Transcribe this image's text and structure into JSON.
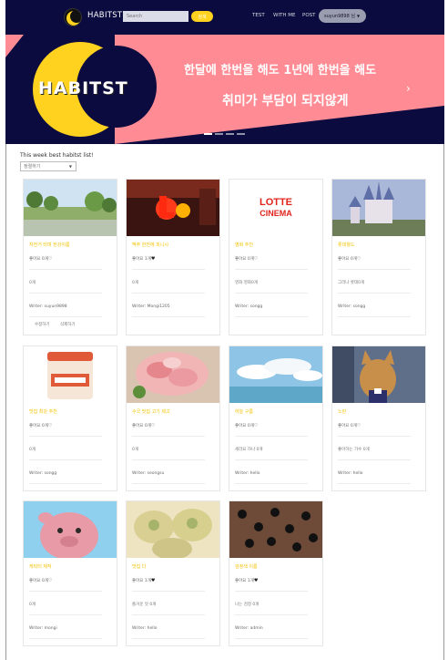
{
  "nav": {
    "brand": "HABITST",
    "search_placeholder": "Search",
    "search_button": "검색",
    "links": [
      "TEST",
      "WITH ME",
      "POST"
    ],
    "user": "suyun9898 님"
  },
  "banner": {
    "logo_text": "HABITST",
    "line1": "한달에 한번을 해도 1년에 한번을 해도",
    "line2": "취미가 부담이 되지않게",
    "next_arrow": "›"
  },
  "list": {
    "title": "This week best habitst list!",
    "sort_value": "정렬하기"
  },
  "cards": [
    {
      "title": "자전거 타며 한강이름",
      "likes": "좋아요 0개",
      "liked": false,
      "desc": "0개",
      "writer": "Writer: suyun9898",
      "actions": [
        "수정하기",
        "삭제하기"
      ],
      "thumb": "park"
    },
    {
      "title": "맥주 한잔에 피니시",
      "likes": "좋아요 1개",
      "liked": true,
      "desc": "0개",
      "writer": "Writer: Mongi1205",
      "thumb": "sign"
    },
    {
      "title": "영화 추천",
      "likes": "좋아요 0개",
      "liked": false,
      "desc": "영화 영화0개",
      "writer": "Writer: songg",
      "thumb": "cinema"
    },
    {
      "title": "롯데월드",
      "likes": "좋아요 0개",
      "liked": false,
      "desc": "그리나 롯데0개",
      "writer": "Writer: songg",
      "thumb": "castle"
    },
    {
      "title": "맛집 최강 추천",
      "likes": "좋아요 0개",
      "liked": false,
      "desc": "0개",
      "writer": "Writer: songg",
      "thumb": "yogurt"
    },
    {
      "title": "수국 맛집 고기 제고",
      "likes": "좋아요 0개",
      "liked": false,
      "desc": "0개",
      "writer": "Writer: seongsu",
      "thumb": "meat"
    },
    {
      "title": "하늘 구름",
      "likes": "좋아요 0개",
      "liked": false,
      "desc": "세라요 하나 0개",
      "writer": "Writer: hello",
      "thumb": "sky"
    },
    {
      "title": "노란",
      "likes": "좋아요 0개",
      "liked": false,
      "desc": "좋아하는 가수 0개",
      "writer": "Writer: hello",
      "thumb": "cat"
    },
    {
      "title": "캐릭터 제작",
      "likes": "좋아요 0개",
      "liked": false,
      "desc": "0개",
      "writer": "Writer: mongi",
      "thumb": "pink"
    },
    {
      "title": "맛집 다",
      "likes": "좋아요 1개",
      "liked": true,
      "desc": "즐거운 맛 0개",
      "writer": "Writer: hello",
      "thumb": "dumpling"
    },
    {
      "title": "검정색 이름",
      "likes": "좋아요 1개",
      "liked": true,
      "desc": "나는 검정 0개",
      "writer": "Writer: admin",
      "thumb": "soot"
    }
  ],
  "icons": {
    "heart_empty": "♡",
    "heart_full": "♥",
    "caret": "▼"
  },
  "colors": {
    "navy": "#0b0b3f",
    "yellow": "#ffd21f",
    "pink": "#ff8c94"
  }
}
